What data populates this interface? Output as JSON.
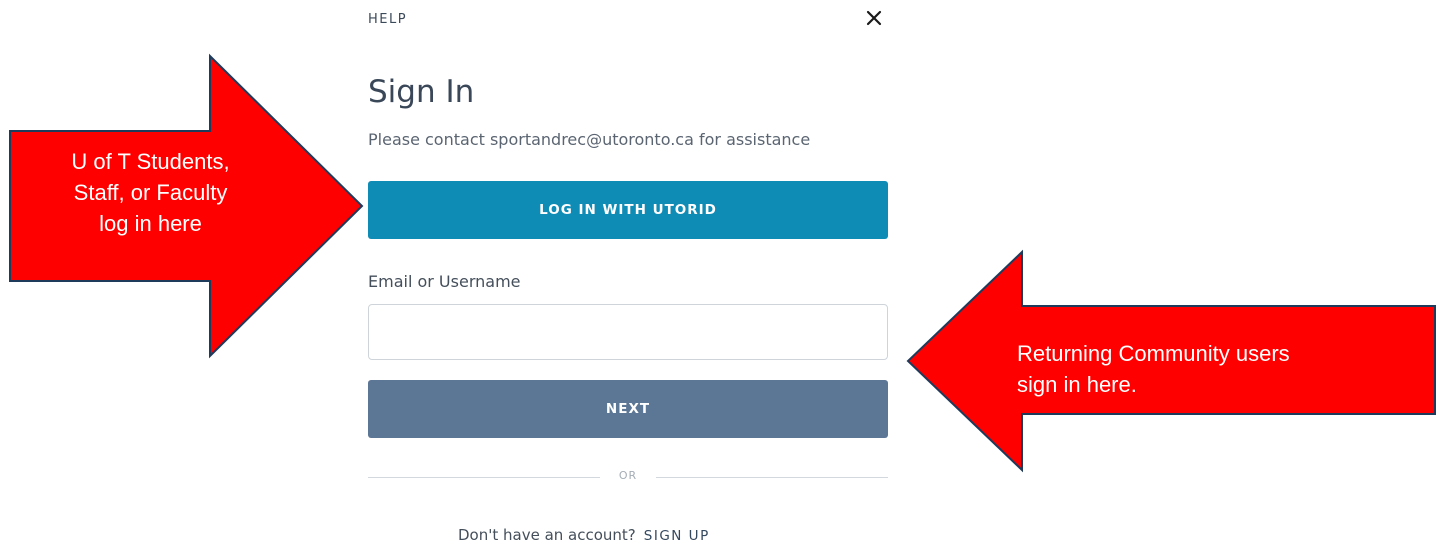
{
  "dialog": {
    "help_label": "HELP",
    "close_icon": "close-icon",
    "title": "Sign In",
    "subtitle": "Please contact sportandrec@utoronto.ca for assistance",
    "utorid_button_label": "LOG IN WITH UTORID",
    "email_label": "Email or Username",
    "email_value": "",
    "email_placeholder": "",
    "next_button_label": "NEXT",
    "divider_text": "OR",
    "signup_prompt": "Don't have an account?",
    "signup_link_label": "SIGN UP"
  },
  "annotations": {
    "left_callout_lines": [
      "U of T Students,",
      "Staff, or Faculty",
      "log in here"
    ],
    "right_callout_lines": [
      "Returning Community users",
      "sign in here."
    ],
    "arrow_color": "#ff0000",
    "arrow_outline_color": "#1f3b5c"
  },
  "colors": {
    "utorid_button": "#0f8cb6",
    "next_button": "#5c7795",
    "text": "#454f5b"
  }
}
